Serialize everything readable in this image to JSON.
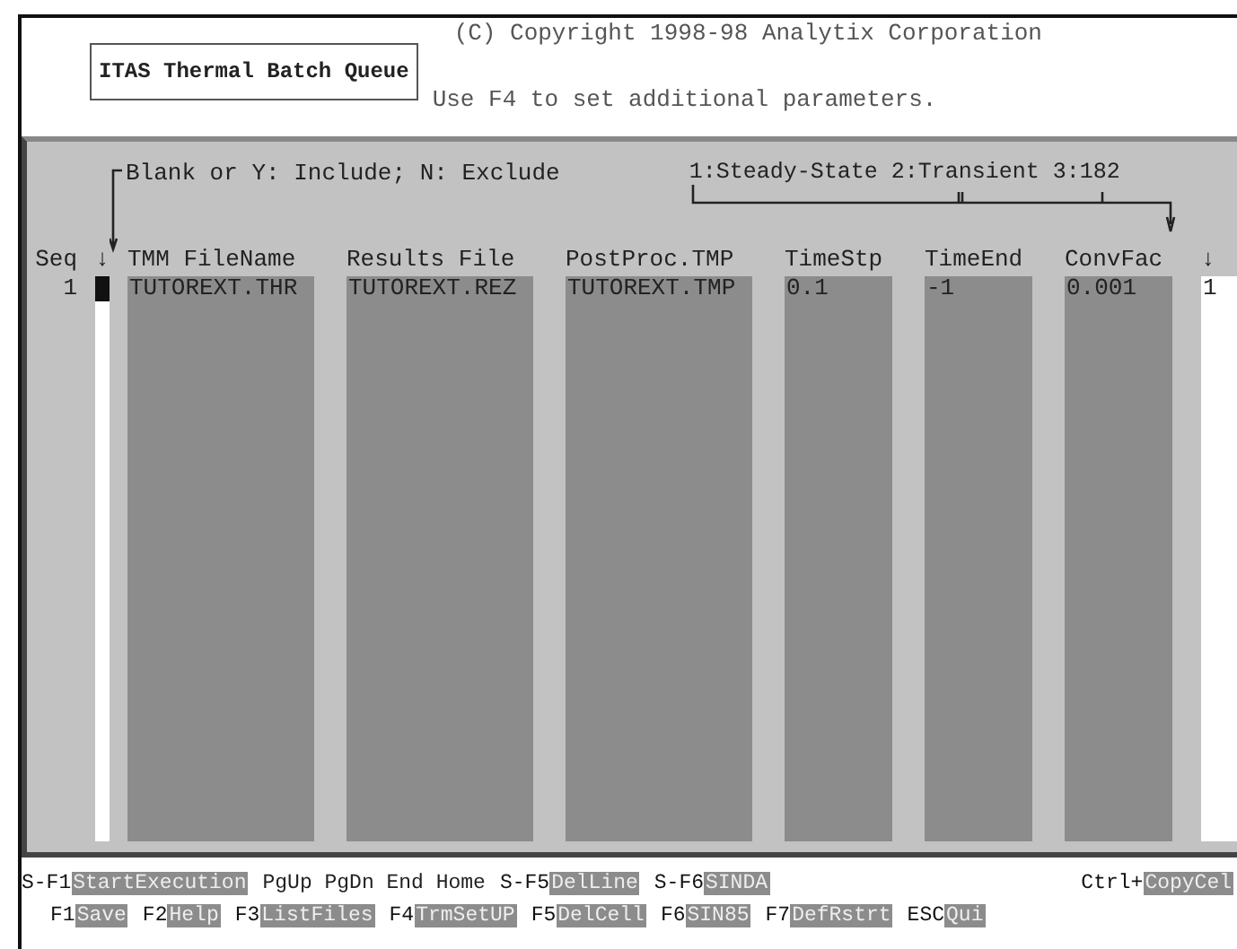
{
  "header": {
    "title": "ITAS Thermal Batch Queue",
    "copyright": "(C) Copyright 1998-98 Analytix Corporation",
    "hint": "Use F4 to set additional parameters."
  },
  "queue": {
    "include_note": "Blank or Y: Include; N: Exclude",
    "mode_note": "1:Steady-State 2:Transient 3:182",
    "columns": [
      {
        "kind": "seq",
        "label": "Seq"
      },
      {
        "kind": "include",
        "label": "↓"
      },
      {
        "kind": "name",
        "label": "TMM FileName"
      },
      {
        "kind": "name",
        "label": "Results File"
      },
      {
        "kind": "name",
        "label": "PostProc.TMP"
      },
      {
        "kind": "number",
        "label": "TimeStp"
      },
      {
        "kind": "number",
        "label": "TimeEnd"
      },
      {
        "kind": "number",
        "label": "ConvFac"
      },
      {
        "kind": "mode",
        "label": "↓"
      }
    ],
    "rows": [
      {
        "cursor": true,
        "cells": [
          "1",
          "",
          "TUTOREXT.THR",
          "TUTOREXT.REZ",
          "TUTOREXT.TMP",
          "0.1",
          "-1",
          "0.001",
          "1"
        ]
      }
    ]
  },
  "keys": [
    [
      {
        "kind": "key",
        "key": "S-F1",
        "label": "StartExecution"
      },
      {
        "kind": "text",
        "text": "PgUp PgDn End Home"
      },
      {
        "kind": "key",
        "key": "S-F5",
        "label": "DelLine"
      },
      {
        "kind": "key",
        "key": "S-F6",
        "label": "SINDA"
      },
      {
        "kind": "key_right",
        "key": "Ctrl+",
        "label": "CopyCel"
      }
    ],
    [
      {
        "kind": "key",
        "key": "F1",
        "label": "Save"
      },
      {
        "kind": "key",
        "key": "F2",
        "label": "Help"
      },
      {
        "kind": "key",
        "key": "F3",
        "label": "ListFiles"
      },
      {
        "kind": "key",
        "key": "F4",
        "label": "TrmSetUP"
      },
      {
        "kind": "key",
        "key": "F5",
        "label": "DelCell"
      },
      {
        "kind": "key",
        "key": "F6",
        "label": "SIN85"
      },
      {
        "kind": "key",
        "key": "F7",
        "label": "DefRstrt"
      },
      {
        "kind": "key",
        "key": "ESC",
        "label": "Qui"
      }
    ]
  ]
}
